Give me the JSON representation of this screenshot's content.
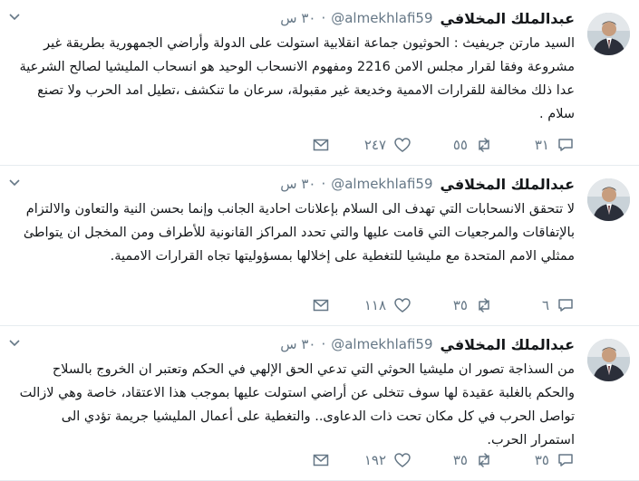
{
  "tweets": [
    {
      "name": "عبدالملك المخلافي",
      "handle": "@almekhlafi59",
      "time": "٣٠ س",
      "text": "السيد مارتن جريفيث : الحوثيون جماعة انقلابية استولت على الدولة وأراضي الجمهورية بطريقة غير مشروعة وفقا لقرار مجلس الامن 2216 ومفهوم الانسحاب الوحيد هو انسحاب المليشيا لصالح الشرعية عدا ذلك مخالفة للقرارات الاممية وخديعة غير مقبولة، سرعان ما تنكشف ،تطيل امد الحرب ولا تصنع سلام .",
      "replies": "٣١",
      "retweets": "٥٥",
      "likes": "٢٤٧"
    },
    {
      "name": "عبدالملك المخلافي",
      "handle": "@almekhlafi59",
      "time": "٣٠ س",
      "text": "لا تتحقق الانسحابات التي تهدف الى السلام بإعلانات احادية الجانب وإنما بحسن النية والتعاون والالتزام بالإتفاقات والمرجعيات التي قامت عليها والتي تحدد المراكز القانونية للأطراف ومن المخجل ان يتواطئ ممثلي الامم المتحدة مع مليشيا للتغطية على إخلالها بمسؤوليتها تجاه القرارات الاممية.",
      "replies": "٦",
      "retweets": "٣٥",
      "likes": "١١٨"
    },
    {
      "name": "عبدالملك المخلافي",
      "handle": "@almekhlafi59",
      "time": "٣٠ س",
      "text": "من السذاجة تصور ان مليشيا الحوثي التي تدعي الحق الإلهي في الحكم وتعتبر ان الخروج بالسلاح والحكم بالغلبة عقيدة لها سوف تتخلى عن أراضي استولت عليها بموجب هذا الاعتقاد، خاصة وهي لازالت تواصل الحرب في كل مكان تحت ذات الدعاوى.. والتغطية على أعمال المليشيا جريمة تؤدي الى استمرار الحرب.",
      "replies": "٣٥",
      "retweets": "٣٥",
      "likes": "١٩٢"
    }
  ]
}
